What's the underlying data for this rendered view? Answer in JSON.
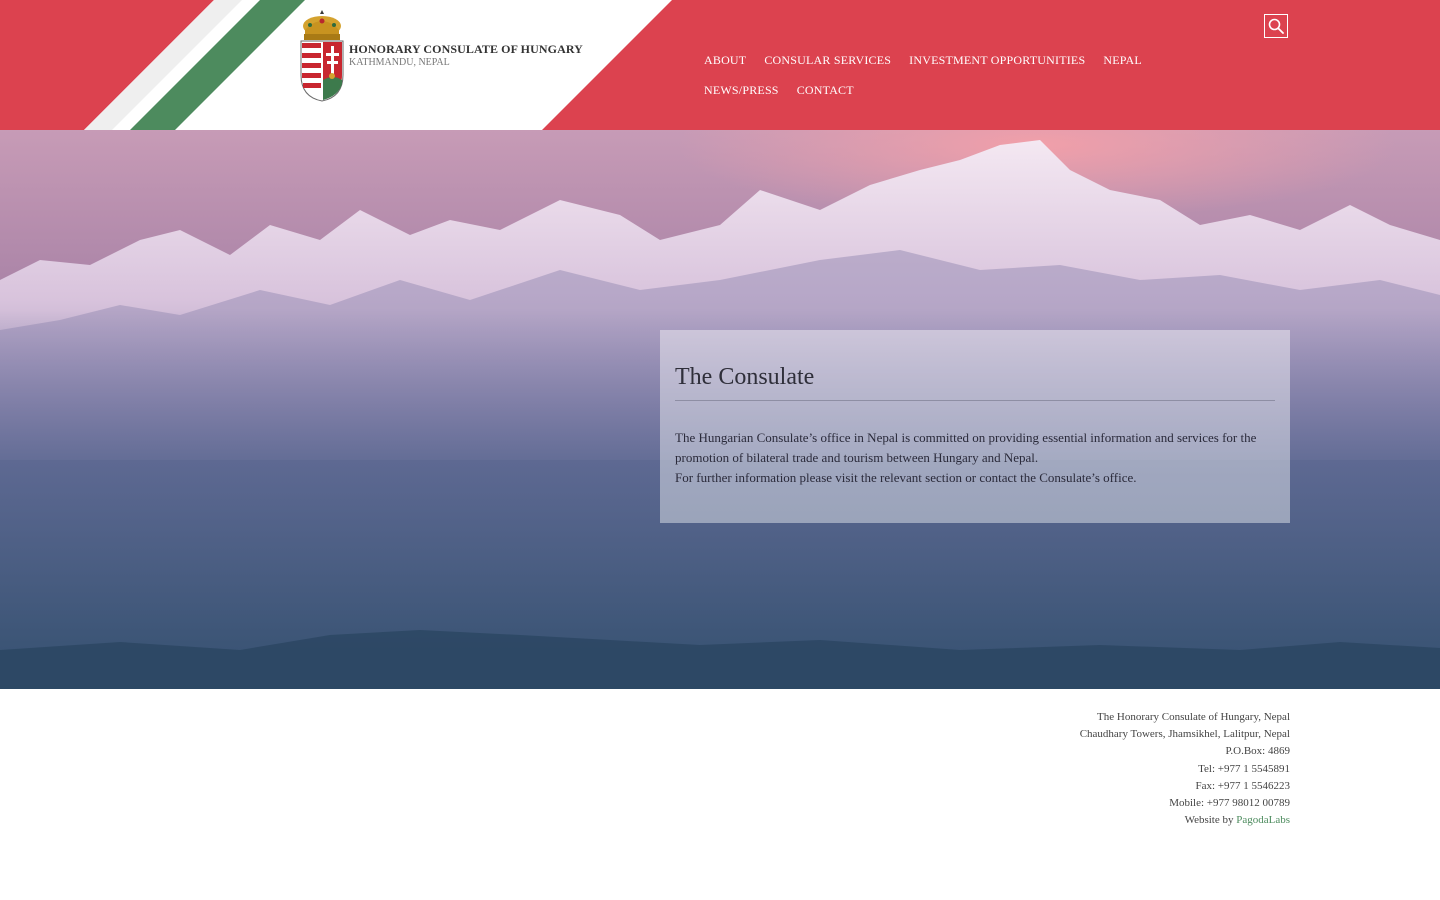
{
  "site": {
    "title": "HONORARY CONSULATE OF HUNGARY",
    "subtitle": "KATHMANDU, NEPAL"
  },
  "nav": {
    "items": [
      {
        "label": "ABOUT"
      },
      {
        "label": "CONSULAR SERVICES"
      },
      {
        "label": "INVESTMENT OPPORTUNITIES"
      },
      {
        "label": "NEPAL"
      },
      {
        "label": "NEWS/PRESS"
      },
      {
        "label": "CONTACT"
      }
    ]
  },
  "search": {
    "icon": "search-icon"
  },
  "hero": {
    "heading": "The Consulate",
    "paragraph1": "The Hungarian Consulate’s office in Nepal is committed on providing essential information and services for the promotion of bilateral trade and tourism between Hungary and Nepal.",
    "paragraph2": "For further information please visit the relevant section or contact the Consulate’s office."
  },
  "footer": {
    "org": "The Honorary Consulate of Hungary, Nepal",
    "address": "Chaudhary Towers, Jhamsikhel, Lalitpur, Nepal",
    "pobox": "P.O.Box: 4869",
    "tel": "Tel: +977 1 5545891",
    "fax": "Fax: +977 1 5546223",
    "mobile": "Mobile: +977 98012 00789",
    "credit_prefix": "Website by ",
    "credit_link": "PagodaLabs"
  },
  "colors": {
    "header_red": "#dc424f",
    "flag_green": "#4d8b5e",
    "footer_link": "#4c8b5d"
  }
}
